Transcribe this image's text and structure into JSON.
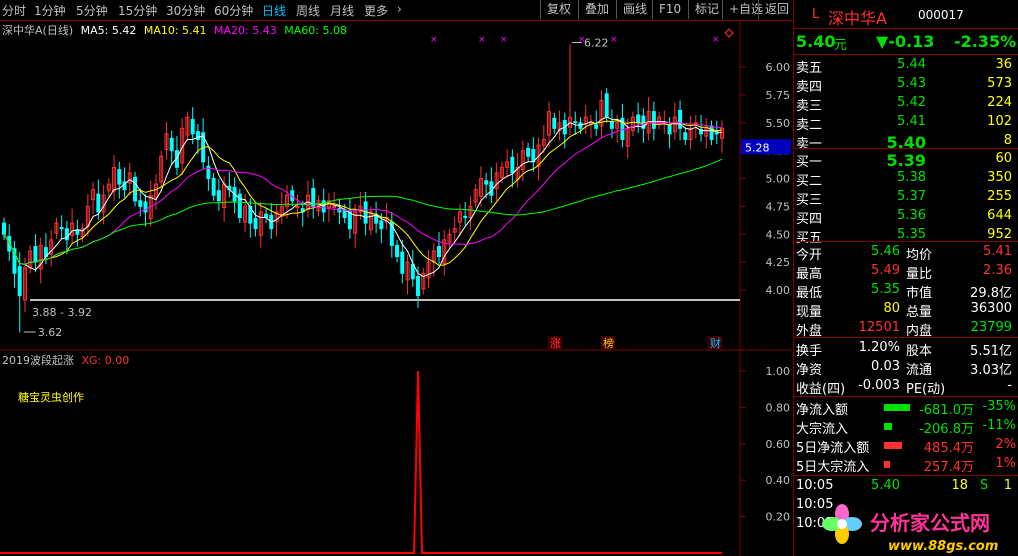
{
  "colors": {
    "up": "#ff3030",
    "down": "#00ffff",
    "ma5": "#ffffff",
    "ma10": "#ffff00",
    "ma20": "#ff00ff",
    "ma60": "#00ff00",
    "grid": "#800000",
    "line": "#ff0000",
    "price_tag_bg": "#0000c0"
  },
  "topbar": {
    "periods": [
      "分时",
      "1分钟",
      "5分钟",
      "15分钟",
      "30分钟",
      "60分钟",
      "日线",
      "周线",
      "月线",
      "更多"
    ],
    "active_period": "日线",
    "more_arrow": "›",
    "buttons": [
      "复权",
      "叠加",
      "画线",
      "F10",
      "标记",
      "+自选",
      "返回"
    ]
  },
  "legend": {
    "title": "深中华A(日线)",
    "ma5": "MA5: 5.42",
    "ma10": "MA10: 5.41",
    "ma20": "MA20: 5.43",
    "ma60": "MA60: 5.08"
  },
  "price_axis": {
    "ticks": [
      "6.00",
      "5.75",
      "5.50",
      "5.25",
      "5.00",
      "4.75",
      "4.50",
      "4.25",
      "4.00"
    ],
    "current_price": "5.28"
  },
  "annotations": {
    "high": "6.22",
    "low": "3.62",
    "range": "3.88 - 3.92",
    "marks": [
      "涨",
      "榜",
      "财"
    ]
  },
  "indicator": {
    "name": "2019波段起涨",
    "xg_label": "XG: 0.00",
    "note": "糖宝灵虫创作",
    "ticks": [
      "1.00",
      "0.80",
      "0.60",
      "0.40",
      "0.20"
    ],
    "chart_data": {
      "type": "line",
      "series": [
        {
          "name": "XG",
          "values": [
            {
              "index": 79,
              "value": 1.0
            }
          ]
        }
      ],
      "ylim": [
        0,
        1
      ]
    }
  },
  "quote": {
    "prefix": "L",
    "name": "深中华A",
    "code": "000017",
    "price": "5.40",
    "price_unit": "元",
    "change": "▼-0.13",
    "change_pct": "-2.35%",
    "asks": [
      [
        "卖五",
        "5.44",
        "36"
      ],
      [
        "卖四",
        "5.43",
        "573"
      ],
      [
        "卖三",
        "5.42",
        "224"
      ],
      [
        "卖二",
        "5.41",
        "102"
      ],
      [
        "卖一",
        "5.40",
        "8"
      ]
    ],
    "bids": [
      [
        "买一",
        "5.39",
        "60"
      ],
      [
        "买二",
        "5.38",
        "350"
      ],
      [
        "买三",
        "5.37",
        "255"
      ],
      [
        "买四",
        "5.36",
        "644"
      ],
      [
        "买五",
        "5.35",
        "952"
      ]
    ],
    "stats": [
      [
        "今开",
        "5.46",
        "均价",
        "5.41"
      ],
      [
        "最高",
        "5.49",
        "量比",
        "2.36"
      ],
      [
        "最低",
        "5.35",
        "市值",
        "29.8亿"
      ],
      [
        "现量",
        "80",
        "总量",
        "36300"
      ],
      [
        "外盘",
        "12501",
        "内盘",
        "23799"
      ]
    ],
    "stats2": [
      [
        "换手",
        "1.20%",
        "股本",
        "5.51亿"
      ],
      [
        "净资",
        "0.03",
        "流通",
        "3.03亿"
      ],
      [
        "收益(四)",
        "-0.003",
        "PE(动)",
        "-"
      ]
    ],
    "flows": [
      [
        "净流入额",
        "-681.0万",
        "-35%"
      ],
      [
        "大宗流入",
        "-206.8万",
        "-11%"
      ],
      [
        "5日净流入额",
        "485.4万",
        "2%"
      ],
      [
        "5日大宗流入",
        "257.4万",
        "1%"
      ]
    ],
    "ticks_table": [
      [
        "10:05",
        "5.40",
        "18",
        "S",
        "1"
      ],
      [
        "10:05",
        "",
        "",
        "",
        ""
      ],
      [
        "10:05",
        "",
        "",
        "",
        ""
      ]
    ]
  },
  "watermark": {
    "text": "分析家公式网",
    "url": "www.88gs.com"
  }
}
